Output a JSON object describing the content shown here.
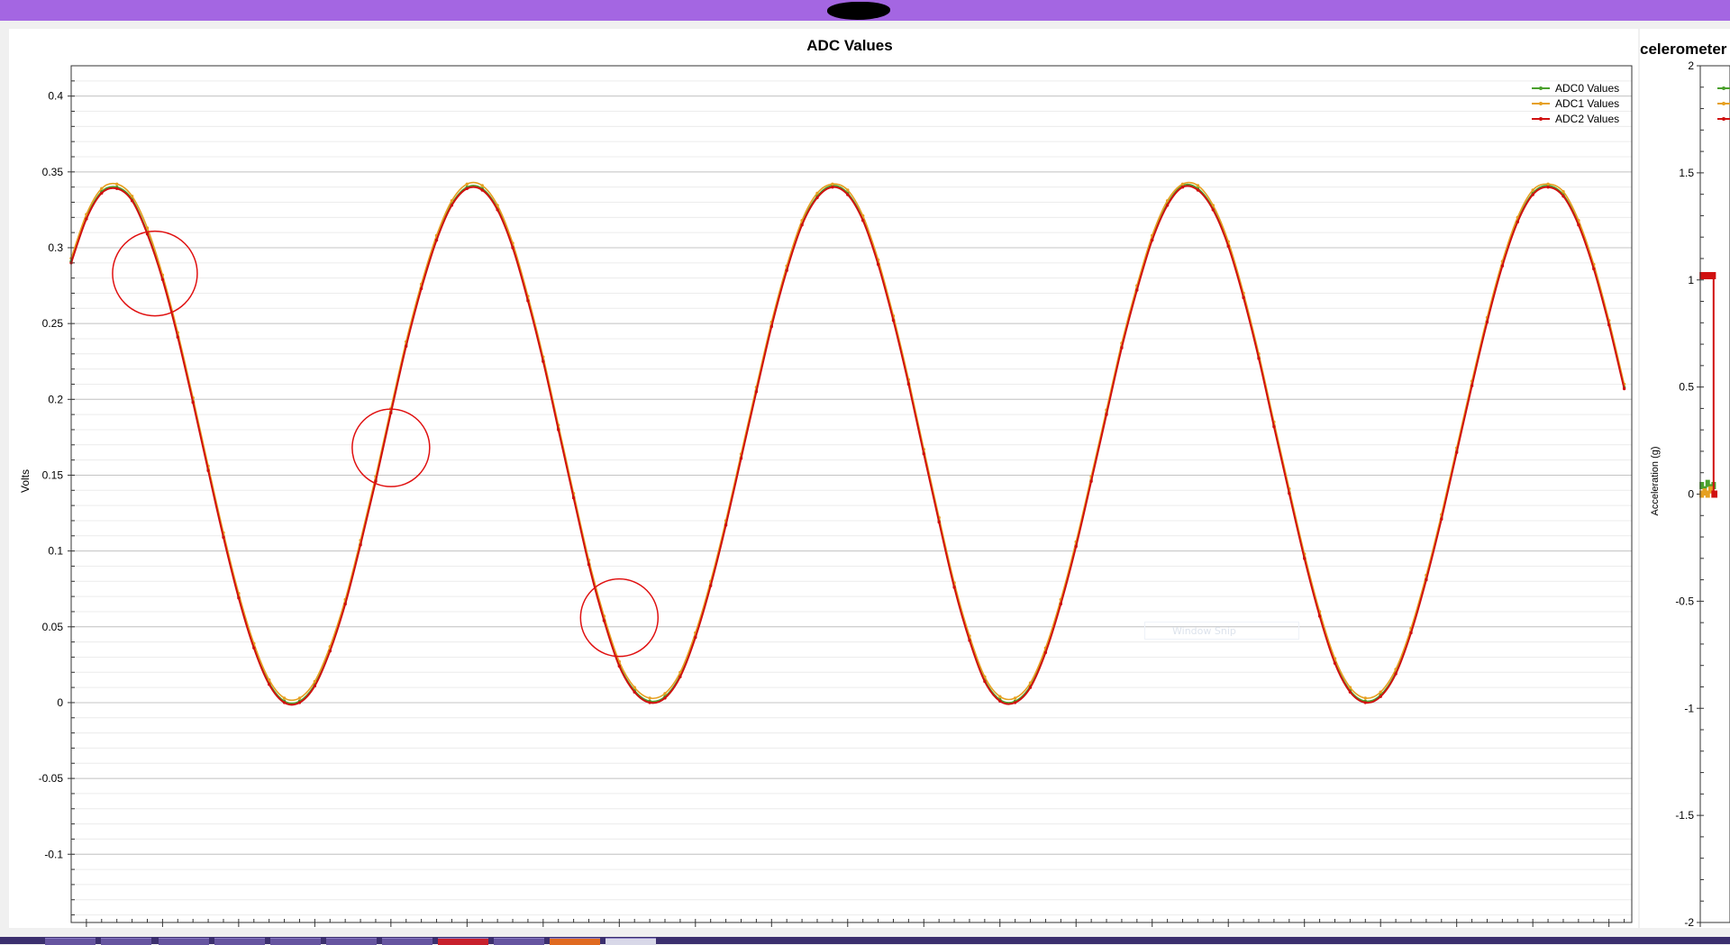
{
  "window": {
    "snip_label": "Window Snip"
  },
  "colors": {
    "titlebar": "#a466e2",
    "adc0": "#4aa02c",
    "adc1": "#e6a020",
    "adc2": "#d01010",
    "annotation": "#e01010"
  },
  "chart_data": [
    {
      "type": "line",
      "title": "ADC Values",
      "xlabel": "",
      "ylabel": "Volts",
      "xlim": [
        18,
        223
      ],
      "ylim": [
        -0.145,
        0.42
      ],
      "xticks": [
        20,
        30,
        40,
        50,
        60,
        70,
        80,
        90,
        100,
        110,
        120,
        130,
        140,
        150,
        160,
        170,
        180,
        190,
        200,
        210,
        220
      ],
      "yticks": [
        -0.1,
        -0.05,
        0,
        0.05,
        0.1,
        0.15,
        0.2,
        0.25,
        0.3,
        0.35,
        0.4
      ],
      "ytick_labels": [
        "-0.1",
        "-0.05",
        "0",
        "0.05",
        "0.1",
        "0.15",
        "0.2",
        "0.25",
        "0.3",
        "0.35",
        "0.4"
      ],
      "grid": true,
      "legend": "top-right",
      "series": [
        {
          "name": "ADC0 Values",
          "color": "#4aa02c",
          "offset": 0.0,
          "x": [
            18,
            20,
            22,
            24,
            26,
            28,
            30,
            32,
            34,
            36,
            38,
            40,
            42,
            44,
            46,
            48,
            50,
            52,
            54,
            56,
            58,
            60,
            62,
            64,
            66,
            68,
            70,
            72,
            74,
            76,
            78,
            80,
            82,
            84,
            86,
            88,
            90,
            92,
            94,
            96,
            98,
            100,
            102,
            104,
            106,
            108,
            110,
            112,
            114,
            116,
            118,
            120,
            122,
            124,
            126,
            128,
            130,
            132,
            134,
            136,
            138,
            140,
            142,
            144,
            146,
            148,
            150,
            152,
            154,
            156,
            158,
            160,
            162,
            164,
            166,
            168,
            170,
            172,
            174,
            176,
            178,
            180,
            182,
            184,
            186,
            188,
            190,
            192,
            194,
            196,
            198,
            200,
            202,
            204,
            206,
            208,
            210,
            212,
            214,
            216,
            218,
            220,
            222
          ],
          "y": [
            0.291,
            0.32,
            0.337,
            0.34,
            0.332,
            0.31,
            0.28,
            0.242,
            0.199,
            0.154,
            0.11,
            0.07,
            0.037,
            0.013,
            0.001,
            0.001,
            0.012,
            0.035,
            0.066,
            0.105,
            0.147,
            0.192,
            0.236,
            0.274,
            0.306,
            0.329,
            0.34,
            0.339,
            0.326,
            0.301,
            0.266,
            0.226,
            0.181,
            0.136,
            0.092,
            0.055,
            0.025,
            0.008,
            0.001,
            0.004,
            0.018,
            0.044,
            0.078,
            0.118,
            0.162,
            0.206,
            0.249,
            0.286,
            0.316,
            0.334,
            0.341,
            0.336,
            0.319,
            0.29,
            0.253,
            0.211,
            0.165,
            0.12,
            0.077,
            0.042,
            0.015,
            0.002,
            0.001,
            0.011,
            0.034,
            0.066,
            0.104,
            0.147,
            0.191,
            0.235,
            0.273,
            0.306,
            0.329,
            0.341,
            0.339,
            0.326,
            0.302,
            0.268,
            0.228,
            0.183,
            0.139,
            0.096,
            0.058,
            0.027,
            0.008,
            0.001,
            0.005,
            0.02,
            0.047,
            0.082,
            0.122,
            0.166,
            0.21,
            0.252,
            0.289,
            0.318,
            0.336,
            0.341,
            0.335,
            0.316,
            0.287,
            0.25,
            0.208
          ]
        },
        {
          "name": "ADC1 Values",
          "color": "#e6a020",
          "offset": 0.003,
          "x": [
            18,
            20,
            22,
            24,
            26,
            28,
            30,
            32,
            34,
            36,
            38,
            40,
            42,
            44,
            46,
            48,
            50,
            52,
            54,
            56,
            58,
            60,
            62,
            64,
            66,
            68,
            70,
            72,
            74,
            76,
            78,
            80,
            82,
            84,
            86,
            88,
            90,
            92,
            94,
            96,
            98,
            100,
            102,
            104,
            106,
            108,
            110,
            112,
            114,
            116,
            118,
            120,
            122,
            124,
            126,
            128,
            130,
            132,
            134,
            136,
            138,
            140,
            142,
            144,
            146,
            148,
            150,
            152,
            154,
            156,
            158,
            160,
            162,
            164,
            166,
            168,
            170,
            172,
            174,
            176,
            178,
            180,
            182,
            184,
            186,
            188,
            190,
            192,
            194,
            196,
            198,
            200,
            202,
            204,
            206,
            208,
            210,
            212,
            214,
            216,
            218,
            220,
            222
          ],
          "y": [
            0.293,
            0.322,
            0.339,
            0.342,
            0.334,
            0.313,
            0.282,
            0.244,
            0.201,
            0.156,
            0.112,
            0.072,
            0.039,
            0.015,
            0.003,
            0.003,
            0.014,
            0.037,
            0.068,
            0.107,
            0.149,
            0.194,
            0.238,
            0.276,
            0.308,
            0.331,
            0.342,
            0.341,
            0.328,
            0.303,
            0.268,
            0.228,
            0.183,
            0.138,
            0.094,
            0.057,
            0.027,
            0.01,
            0.003,
            0.006,
            0.02,
            0.046,
            0.08,
            0.12,
            0.164,
            0.208,
            0.251,
            0.288,
            0.318,
            0.336,
            0.342,
            0.338,
            0.321,
            0.292,
            0.255,
            0.213,
            0.167,
            0.122,
            0.079,
            0.044,
            0.017,
            0.004,
            0.003,
            0.013,
            0.036,
            0.068,
            0.106,
            0.149,
            0.193,
            0.237,
            0.275,
            0.308,
            0.331,
            0.342,
            0.341,
            0.328,
            0.304,
            0.27,
            0.23,
            0.185,
            0.141,
            0.098,
            0.06,
            0.029,
            0.01,
            0.003,
            0.007,
            0.022,
            0.049,
            0.084,
            0.124,
            0.168,
            0.212,
            0.254,
            0.291,
            0.32,
            0.338,
            0.342,
            0.337,
            0.318,
            0.289,
            0.252,
            0.21
          ]
        },
        {
          "name": "ADC2 Values",
          "color": "#d01010",
          "offset": -0.001,
          "x": [
            18,
            20,
            22,
            24,
            26,
            28,
            30,
            32,
            34,
            36,
            38,
            40,
            42,
            44,
            46,
            48,
            50,
            52,
            54,
            56,
            58,
            60,
            62,
            64,
            66,
            68,
            70,
            72,
            74,
            76,
            78,
            80,
            82,
            84,
            86,
            88,
            90,
            92,
            94,
            96,
            98,
            100,
            102,
            104,
            106,
            108,
            110,
            112,
            114,
            116,
            118,
            120,
            122,
            124,
            126,
            128,
            130,
            132,
            134,
            136,
            138,
            140,
            142,
            144,
            146,
            148,
            150,
            152,
            154,
            156,
            158,
            160,
            162,
            164,
            166,
            168,
            170,
            172,
            174,
            176,
            178,
            180,
            182,
            184,
            186,
            188,
            190,
            192,
            194,
            196,
            198,
            200,
            202,
            204,
            206,
            208,
            210,
            212,
            214,
            216,
            218,
            220,
            222
          ],
          "y": [
            0.29,
            0.319,
            0.336,
            0.339,
            0.331,
            0.309,
            0.279,
            0.241,
            0.198,
            0.153,
            0.109,
            0.069,
            0.036,
            0.012,
            0.0,
            0.0,
            0.011,
            0.034,
            0.065,
            0.104,
            0.146,
            0.191,
            0.235,
            0.273,
            0.305,
            0.328,
            0.339,
            0.338,
            0.325,
            0.3,
            0.265,
            0.225,
            0.18,
            0.135,
            0.091,
            0.054,
            0.024,
            0.007,
            0.0,
            0.003,
            0.017,
            0.043,
            0.077,
            0.117,
            0.161,
            0.205,
            0.248,
            0.285,
            0.315,
            0.333,
            0.34,
            0.335,
            0.318,
            0.289,
            0.252,
            0.21,
            0.164,
            0.119,
            0.076,
            0.041,
            0.014,
            0.001,
            0.0,
            0.01,
            0.033,
            0.065,
            0.103,
            0.146,
            0.19,
            0.234,
            0.272,
            0.305,
            0.328,
            0.34,
            0.338,
            0.325,
            0.301,
            0.267,
            0.227,
            0.182,
            0.138,
            0.095,
            0.057,
            0.026,
            0.007,
            0.0,
            0.004,
            0.019,
            0.046,
            0.081,
            0.121,
            0.165,
            0.209,
            0.251,
            0.288,
            0.317,
            0.335,
            0.34,
            0.334,
            0.315,
            0.286,
            0.249,
            0.207
          ]
        }
      ],
      "annotations": [
        {
          "shape": "circle",
          "x": 29,
          "y": 0.283,
          "color": "#e01010"
        },
        {
          "shape": "circle",
          "x": 60,
          "y": 0.168,
          "color": "#e01010"
        },
        {
          "shape": "circle",
          "x": 90,
          "y": 0.056,
          "color": "#e01010"
        }
      ]
    },
    {
      "type": "line",
      "title": "celerometer",
      "xlabel": "",
      "ylabel": "Acceleration (g)",
      "xlim": [
        0,
        2
      ],
      "ylim": [
        -2,
        2
      ],
      "xticks": [
        0
      ],
      "yticks": [
        -2,
        -1.5,
        -1,
        -0.5,
        0,
        0.5,
        1,
        1.5,
        2
      ],
      "ytick_labels": [
        "-2",
        "-1.5",
        "-1",
        "-0.5",
        "0",
        "0.5",
        "1",
        "1.5",
        "2"
      ],
      "grid": false,
      "legend": "top-right",
      "series": [
        {
          "color": "#4aa02c",
          "x": [
            0.1,
            0.3,
            0.5,
            0.7,
            0.9
          ],
          "y": [
            0.04,
            0.02,
            0.05,
            0.03,
            0.04
          ]
        },
        {
          "color": "#e6a020",
          "x": [
            0.1,
            0.3,
            0.5,
            0.7,
            0.9
          ],
          "y": [
            0.0,
            0.01,
            0.0,
            0.02,
            0.0
          ]
        },
        {
          "color": "#d01010",
          "x": [
            0.1,
            0.3,
            0.5,
            0.7,
            0.9,
            0.9,
            1.0
          ],
          "y": [
            1.02,
            1.02,
            1.02,
            1.02,
            1.02,
            0.0,
            0.0
          ]
        }
      ]
    }
  ]
}
